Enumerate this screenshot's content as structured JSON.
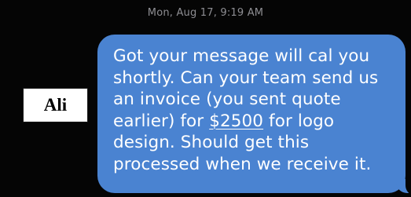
{
  "conversation": {
    "timestamp": "Mon, Aug 17, 9:19 AM",
    "message": {
      "before_amount": "Got your message will cal you\nshortly. Can your team send us\nan invoice (you sent quote\nearlier) for ",
      "amount": "$2500",
      "after_amount": " for logo\ndesign. Should get this\nprocessed when we receive it."
    },
    "bubble_color": "#4a83d1"
  },
  "overlay": {
    "name": "Ali"
  }
}
